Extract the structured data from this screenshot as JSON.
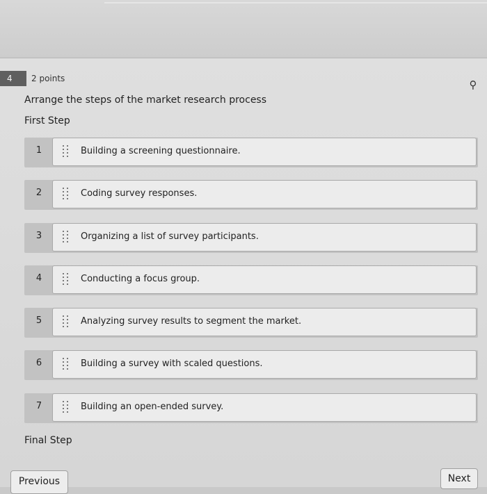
{
  "question": {
    "number": "4",
    "points": "2 points",
    "prompt": "Arrange the steps of the market research process",
    "first_step_label": "First Step",
    "final_step_label": "Final Step"
  },
  "items": [
    {
      "position": "1",
      "label": "Building a screening questionnaire."
    },
    {
      "position": "2",
      "label": "Coding survey responses."
    },
    {
      "position": "3",
      "label": "Organizing a list of survey participants."
    },
    {
      "position": "4",
      "label": "Conducting a focus group."
    },
    {
      "position": "5",
      "label": "Analyzing survey results to segment the market."
    },
    {
      "position": "6",
      "label": "Building a survey with scaled questions."
    },
    {
      "position": "7",
      "label": "Building an open-ended survey."
    }
  ],
  "icons": {
    "pin": "pin-icon",
    "drag": "drag-handle-icon"
  },
  "navigation": {
    "previous_label": "Previous",
    "next_label": "Next"
  }
}
